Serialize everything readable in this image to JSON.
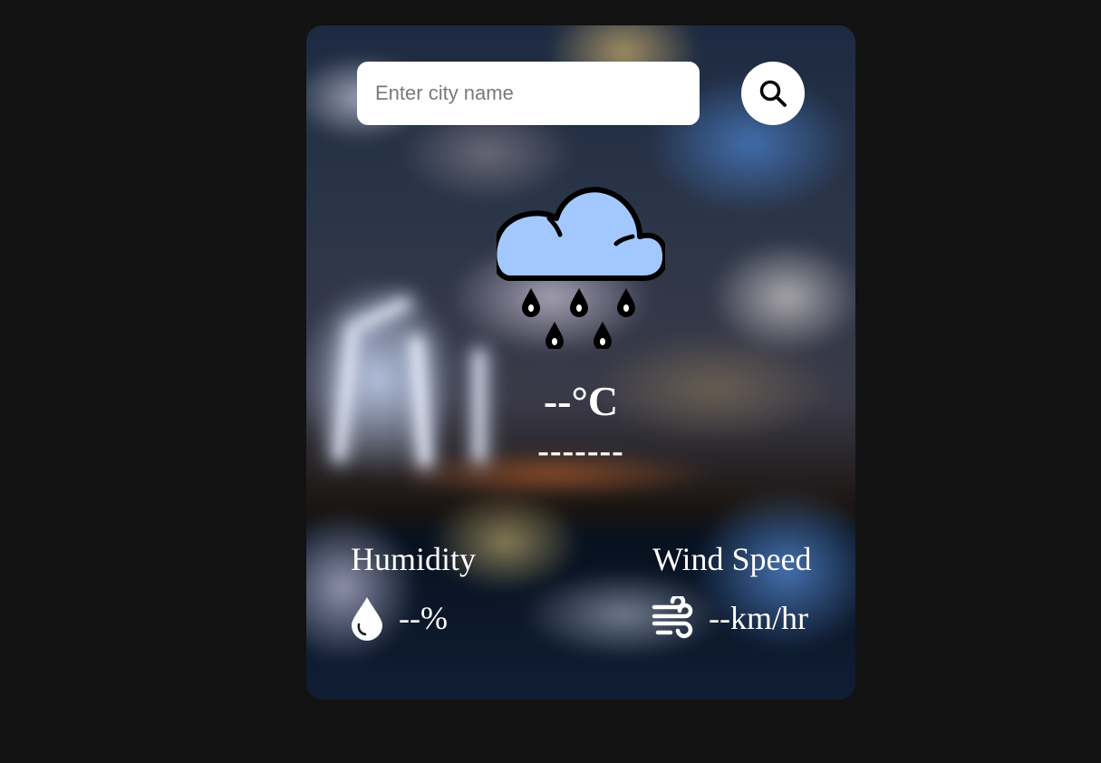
{
  "search": {
    "placeholder": "Enter city name",
    "value": ""
  },
  "icons": {
    "search": "search-icon",
    "weather": "rain-cloud-icon",
    "humidity": "water-drop-icon",
    "wind": "wind-icon"
  },
  "weather": {
    "temperature": "--°C",
    "city": "-------"
  },
  "details": {
    "humidity": {
      "label": "Humidity",
      "value": "--%"
    },
    "wind": {
      "label": "Wind Speed",
      "value": "--km/hr"
    }
  },
  "colors": {
    "page_background": "#121212",
    "cloud_fill": "#a3c8ff",
    "text": "#ffffff"
  }
}
